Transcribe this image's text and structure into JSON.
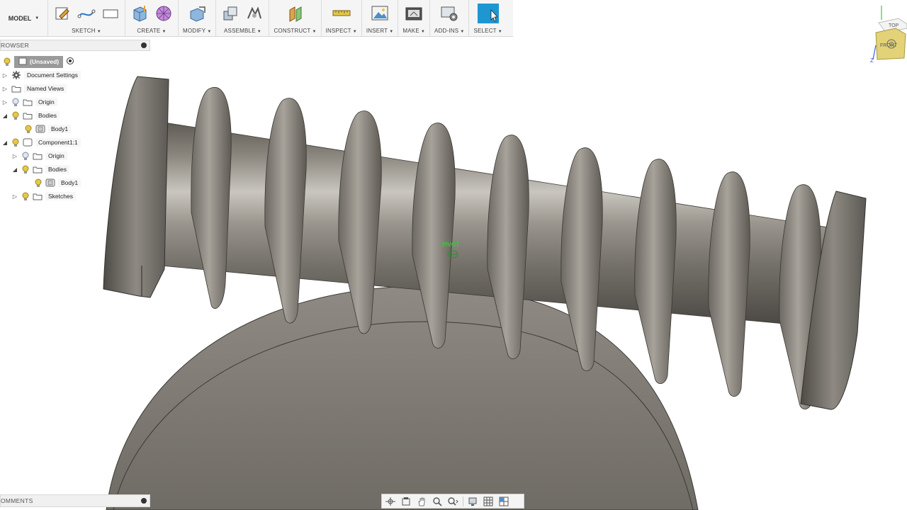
{
  "workspace": {
    "label": "MODEL"
  },
  "toolbar": {
    "groups": [
      {
        "label": "SKETCH"
      },
      {
        "label": "CREATE"
      },
      {
        "label": "MODIFY"
      },
      {
        "label": "ASSEMBLE"
      },
      {
        "label": "CONSTRUCT"
      },
      {
        "label": "INSPECT"
      },
      {
        "label": "INSERT"
      },
      {
        "label": "MAKE"
      },
      {
        "label": "ADD-INS"
      },
      {
        "label": "SELECT"
      }
    ]
  },
  "browser": {
    "title": "ROWSER",
    "tree": [
      {
        "label": "(Unsaved)",
        "icon": "document-icon"
      },
      {
        "label": "Document Settings",
        "icon": "gear-icon"
      },
      {
        "label": "Named Views",
        "icon": "folder-icon"
      },
      {
        "label": "Origin",
        "icon": "folder-icon"
      },
      {
        "label": "Bodies",
        "icon": "folder-icon"
      },
      {
        "label": "Body1",
        "icon": "body-icon"
      },
      {
        "label": "Component1:1",
        "icon": "component-icon"
      },
      {
        "label": "Origin",
        "icon": "folder-icon"
      },
      {
        "label": "Bodies",
        "icon": "folder-icon"
      },
      {
        "label": "Body1",
        "icon": "body-icon"
      },
      {
        "label": "Sketches",
        "icon": "folder-icon"
      }
    ]
  },
  "comments": {
    "title": "OMMENTS"
  },
  "viewport": {
    "pivot_label": "PIVOT",
    "viewcube": {
      "top": "TOP",
      "front": "FRONT",
      "axis_z": "Z"
    }
  },
  "colors": {
    "accent": "#1e96d2",
    "pivot": "#3cc83c",
    "metal": "#8a857d",
    "bulb": "#e6c84a"
  }
}
